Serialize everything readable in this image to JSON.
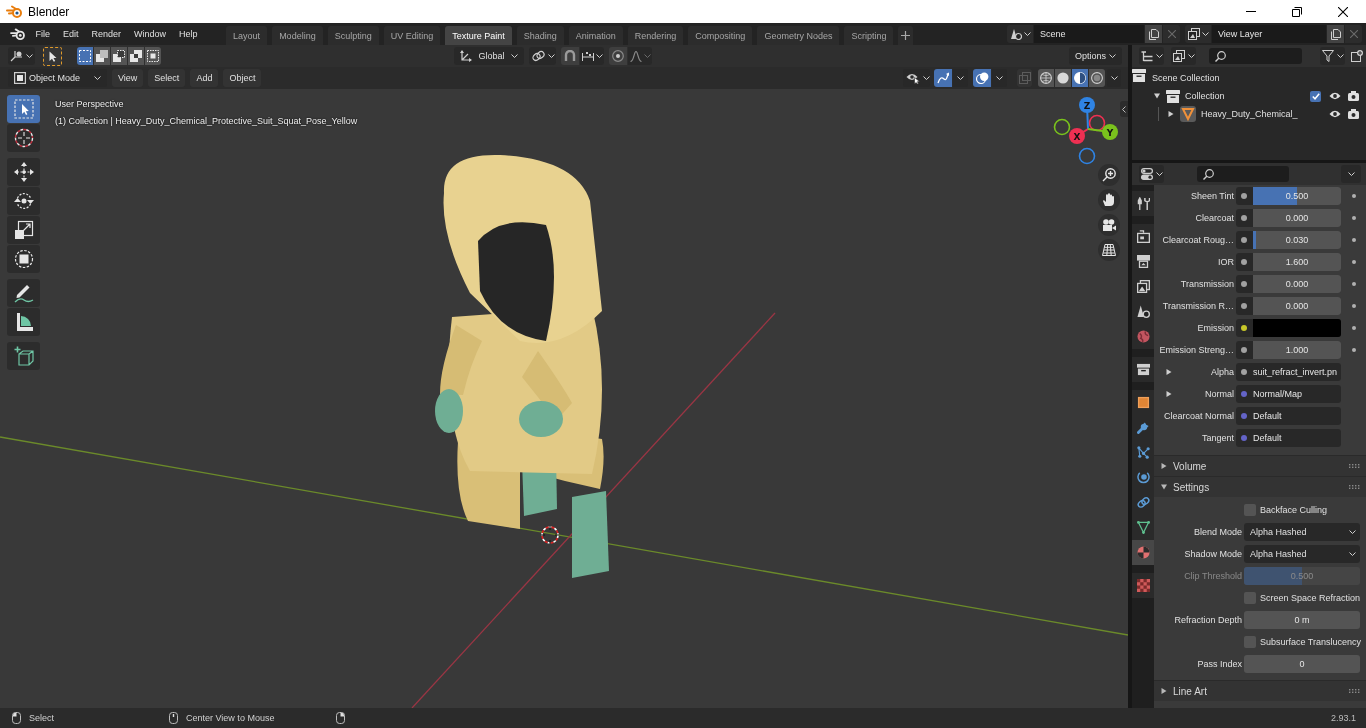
{
  "window": {
    "title": "Blender"
  },
  "menu": [
    "File",
    "Edit",
    "Render",
    "Window",
    "Help"
  ],
  "workspace_tabs": [
    {
      "label": "Layout",
      "selected": false
    },
    {
      "label": "Modeling",
      "selected": false
    },
    {
      "label": "Sculpting",
      "selected": false
    },
    {
      "label": "UV Editing",
      "selected": false
    },
    {
      "label": "Texture Paint",
      "selected": true
    },
    {
      "label": "Shading",
      "selected": false
    },
    {
      "label": "Animation",
      "selected": false
    },
    {
      "label": "Rendering",
      "selected": false
    },
    {
      "label": "Compositing",
      "selected": false
    },
    {
      "label": "Geometry Nodes",
      "selected": false
    },
    {
      "label": "Scripting",
      "selected": false
    }
  ],
  "scene": {
    "value": "Scene"
  },
  "view_layer": {
    "value": "View Layer"
  },
  "tool_header": {
    "select_modes": [
      {
        "kind": "set",
        "selected": true
      },
      {
        "kind": "extend",
        "selected": false
      },
      {
        "kind": "subtract",
        "selected": false
      },
      {
        "kind": "difference",
        "selected": false
      },
      {
        "kind": "intersect",
        "selected": false
      }
    ],
    "transform_orientation": "Global",
    "snap_on": false,
    "proportional_on": false,
    "options": "Options"
  },
  "viewport_header": {
    "mode": "Object Mode",
    "menus": [
      "View",
      "Select",
      "Add",
      "Object"
    ],
    "gizmos_on": true,
    "overlays_on": true,
    "shading_modes": [
      {
        "kind": "wireframe",
        "selected": false
      },
      {
        "kind": "solid",
        "selected": false
      },
      {
        "kind": "material",
        "selected": true
      },
      {
        "kind": "rendered",
        "selected": false
      }
    ]
  },
  "viewport": {
    "view_name": "User Perspective",
    "object_info": "(1) Collection | Heavy_Duty_Chemical_Protective_Suit_Squat_Pose_Yellow",
    "tool_groups": [
      {
        "tools": [
          {
            "kind": "select",
            "selected": true
          },
          {
            "kind": "cursor",
            "selected": false
          }
        ]
      },
      {
        "tools": [
          {
            "kind": "move",
            "selected": false
          },
          {
            "kind": "rotate",
            "selected": false
          },
          {
            "kind": "scale",
            "selected": false
          },
          {
            "kind": "transform",
            "selected": false
          }
        ]
      },
      {
        "tools": [
          {
            "kind": "annotate",
            "selected": false
          },
          {
            "kind": "measure",
            "selected": false
          }
        ]
      },
      {
        "tools": [
          {
            "kind": "add_cube",
            "selected": false
          }
        ]
      }
    ],
    "axes": [
      {
        "kind": "z",
        "label": "Z",
        "color": "#2f83e3"
      },
      {
        "kind": "x",
        "label": "X",
        "color": "#ee3052"
      },
      {
        "kind": "y",
        "label": "Y",
        "color": "#7ac21d"
      }
    ]
  },
  "outliner": {
    "tree": [
      {
        "kind": "scene",
        "label": "Scene Collection",
        "children": [
          {
            "kind": "collection",
            "label": "Collection",
            "expanded": true,
            "checked": true,
            "children": [
              {
                "kind": "object",
                "label": "Heavy_Duty_Chemical_",
                "expanded": false
              }
            ]
          }
        ]
      }
    ]
  },
  "properties": {
    "tab_groups": [
      {
        "tabs": [
          {
            "kind": "tool",
            "selected": false
          }
        ]
      },
      {
        "tabs": [
          {
            "kind": "render",
            "selected": false
          },
          {
            "kind": "output",
            "selected": false
          },
          {
            "kind": "view_layer",
            "selected": false
          },
          {
            "kind": "scene",
            "selected": false
          },
          {
            "kind": "world",
            "selected": false
          }
        ]
      },
      {
        "tabs": [
          {
            "kind": "collection",
            "selected": false
          }
        ]
      },
      {
        "tabs": [
          {
            "kind": "object",
            "selected": false
          },
          {
            "kind": "modifiers",
            "selected": false
          },
          {
            "kind": "particles",
            "selected": false
          },
          {
            "kind": "physics",
            "selected": false
          },
          {
            "kind": "constraints",
            "selected": false
          },
          {
            "kind": "data",
            "selected": false
          },
          {
            "kind": "material",
            "selected": true
          }
        ]
      },
      {
        "tabs": [
          {
            "kind": "texture",
            "selected": false
          }
        ]
      }
    ],
    "inputs": [
      {
        "kind": "slider",
        "label": "Sheen Tint",
        "color": "#a1a1a1",
        "value": "0.500",
        "level": 0.5
      },
      {
        "kind": "slider",
        "label": "Clearcoat",
        "color": "#a1a1a1",
        "value": "0.000",
        "level": 0
      },
      {
        "kind": "slider",
        "label": "Clearcoat Roug…",
        "color": "#a1a1a1",
        "value": "0.030",
        "level": 0.03
      },
      {
        "kind": "number",
        "label": "IOR",
        "color": "#a1a1a1",
        "value": "1.600"
      },
      {
        "kind": "slider",
        "label": "Transmission",
        "color": "#a1a1a1",
        "value": "0.000",
        "level": 0
      },
      {
        "kind": "slider",
        "label": "Transmission R…",
        "color": "#a1a1a1",
        "value": "0.000",
        "level": 0
      },
      {
        "kind": "color",
        "label": "Emission",
        "color": "#c7c729",
        "swatch": {
          "color": "#000000"
        }
      },
      {
        "kind": "number",
        "label": "Emission Streng…",
        "color": "#a1a1a1",
        "value": "1.000"
      },
      {
        "kind": "link",
        "label": "Alpha",
        "color": "#a1a1a1",
        "value": "suit_refract_invert.pn",
        "expanded": false
      },
      {
        "kind": "link",
        "label": "Normal",
        "color": "#6363c7",
        "value": "Normal/Map",
        "expanded": false
      },
      {
        "kind": "link",
        "label": "Clearcoat Normal",
        "color": "#6363c7",
        "value": "Default"
      },
      {
        "kind": "link",
        "label": "Tangent",
        "color": "#6363c7",
        "value": "Default"
      }
    ],
    "panels": [
      {
        "title": "Volume",
        "expanded": false
      },
      {
        "title": "Settings",
        "expanded": true,
        "rows": [
          {
            "kind": "checkbox",
            "label": "Backface Culling",
            "checked": false,
            "disabled": false
          },
          {
            "kind": "dropdown",
            "label": "Blend Mode",
            "value": "Alpha Hashed",
            "disabled": false
          },
          {
            "kind": "dropdown",
            "label": "Shadow Mode",
            "value": "Alpha Hashed",
            "disabled": false
          },
          {
            "kind": "slider",
            "label": "Clip Threshold",
            "value": "0.500",
            "level": 0.5,
            "disabled": true
          },
          {
            "kind": "checkbox",
            "label": "Screen Space Refraction",
            "checked": false,
            "disabled": false
          },
          {
            "kind": "number",
            "label": "Refraction Depth",
            "value": "0 m",
            "disabled": false
          },
          {
            "kind": "checkbox",
            "label": "Subsurface Translucency",
            "checked": false,
            "disabled": false
          },
          {
            "kind": "number",
            "label": "Pass Index",
            "value": "0",
            "disabled": false
          }
        ]
      },
      {
        "title": "Line Art",
        "expanded": false
      }
    ]
  },
  "status_bar": {
    "hints": [
      {
        "label": "Select"
      },
      {
        "label": "Center View to Mouse"
      }
    ],
    "version": "2.93.1"
  }
}
